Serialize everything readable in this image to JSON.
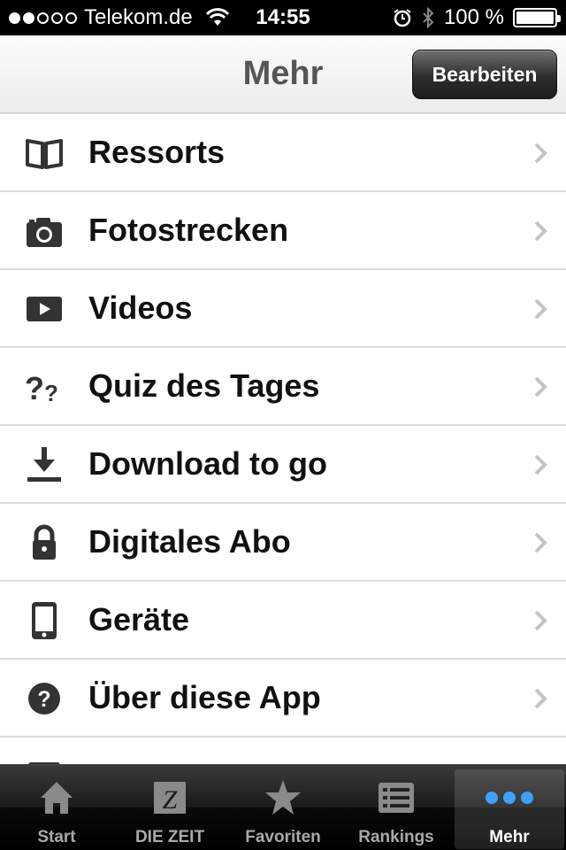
{
  "status_bar": {
    "carrier": "Telekom.de",
    "time": "14:55",
    "battery": "100 %",
    "signal_bars_filled": 2,
    "signal_bars_total": 5
  },
  "nav": {
    "title": "Mehr",
    "edit_button": "Bearbeiten"
  },
  "menu": {
    "items": [
      {
        "label": "Ressorts",
        "icon": "book-icon"
      },
      {
        "label": "Fotostrecken",
        "icon": "camera-icon"
      },
      {
        "label": "Videos",
        "icon": "play-icon"
      },
      {
        "label": "Quiz des Tages",
        "icon": "question-marks-icon"
      },
      {
        "label": "Download to go",
        "icon": "download-icon"
      },
      {
        "label": "Digitales Abo",
        "icon": "lock-icon"
      },
      {
        "label": "Geräte",
        "icon": "phone-icon"
      },
      {
        "label": "Über diese App",
        "icon": "help-circle-icon"
      }
    ]
  },
  "tabbar": {
    "tabs": [
      {
        "label": "Start",
        "icon": "home-icon",
        "active": false
      },
      {
        "label": "DIE ZEIT",
        "icon": "zeit-logo-icon",
        "active": false
      },
      {
        "label": "Favoriten",
        "icon": "star-icon",
        "active": false
      },
      {
        "label": "Rankings",
        "icon": "list-icon",
        "active": false
      },
      {
        "label": "Mehr",
        "icon": "more-dots-icon",
        "active": true
      }
    ]
  },
  "colors": {
    "accent_blue": "#3fa0ff",
    "nav_title": "#555555",
    "row_text": "#111111"
  }
}
